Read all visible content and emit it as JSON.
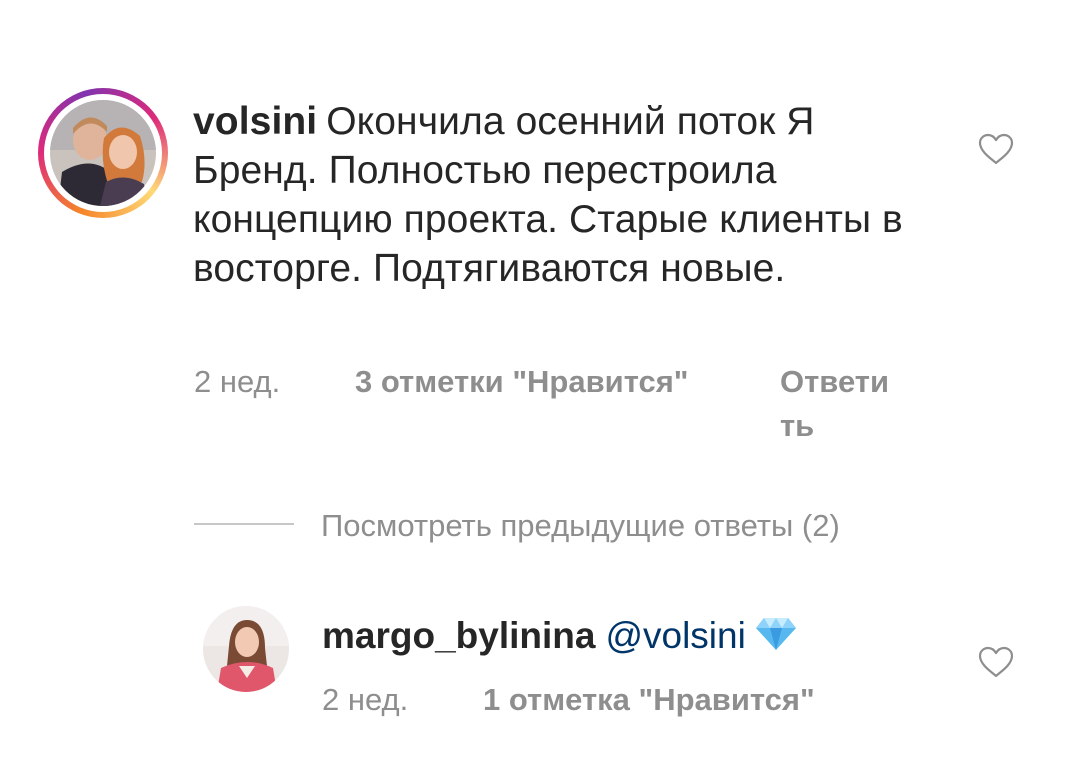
{
  "comments": [
    {
      "username": "volsini",
      "text": "Окончила осенний поток Я Бренд. Полностью перестроила концепцию проекта. Старые клиенты в восторге. Подтягиваются новые.",
      "time": "2 нед.",
      "likes": "3 отметки \"Нравится\"",
      "reply": "Ответить",
      "avatar_icon": "user-photo-avatar",
      "has_story_ring": true
    }
  ],
  "view_previous_replies": "Посмотреть предыдущие ответы (2)",
  "replies": [
    {
      "username": "margo_bylinina",
      "mention": "@volsini",
      "emoji_icon": "gem-icon",
      "time": "2 нед.",
      "likes": "1 отметка \"Нравится\"",
      "avatar_icon": "user-photo-avatar"
    }
  ],
  "colors": {
    "text": "#262626",
    "secondary": "#8e8e8e",
    "mention": "#003569",
    "divider": "#c7c7c7"
  }
}
